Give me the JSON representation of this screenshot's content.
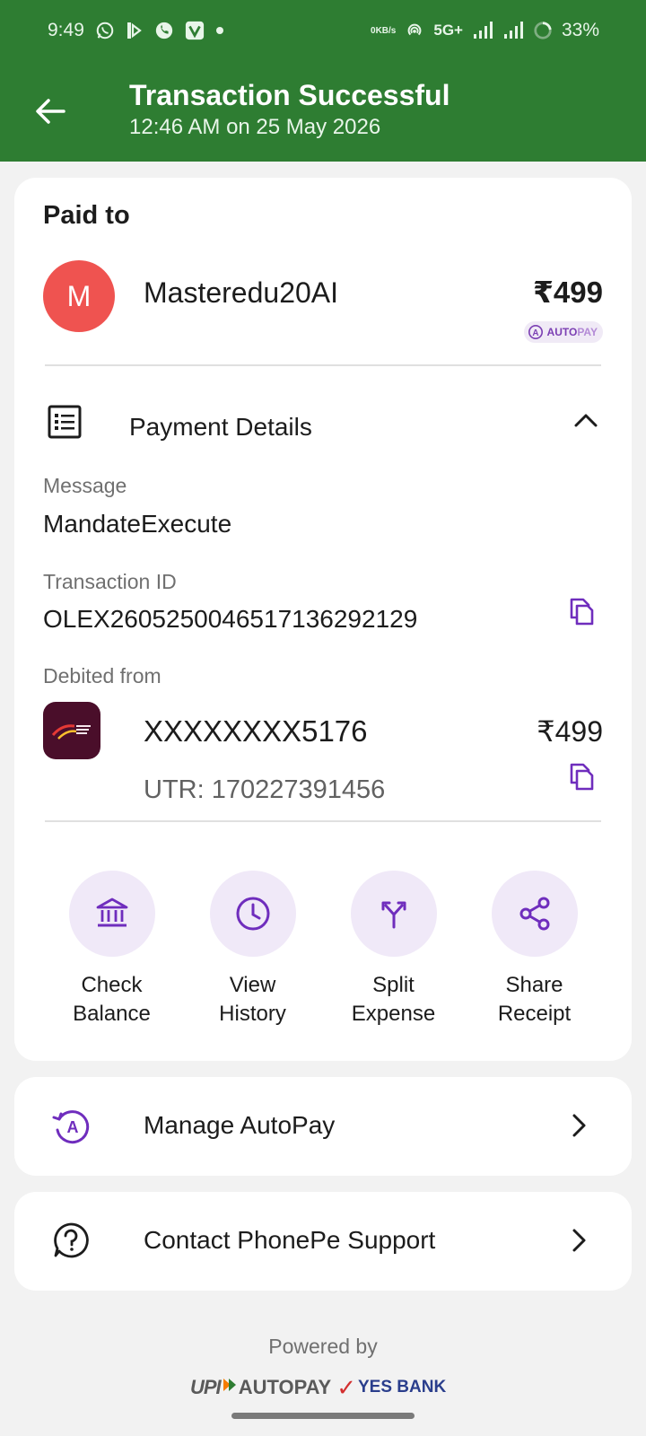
{
  "status": {
    "time": "9:49",
    "kbs_value": "0",
    "kbs_unit": "KB/s",
    "network": "5G+",
    "battery": "33%"
  },
  "header": {
    "title": "Transaction Successful",
    "subtitle": "12:46 AM on 25 May 2026",
    "bg_color": "#2e7d32"
  },
  "payee": {
    "section_title": "Paid to",
    "avatar_letter": "M",
    "name": "Masteredu20AI",
    "amount": "₹499",
    "badge_auto": "AUTO",
    "badge_pay": "PAY"
  },
  "payment_details": {
    "label": "Payment Details",
    "message_label": "Message",
    "message_value": "MandateExecute",
    "txn_label": "Transaction ID",
    "txn_value": "OLEX26052500465171362921​29",
    "debited_label": "Debited from",
    "account": "XXXXXXXX5176",
    "account_amount": "₹499",
    "utr": "UTR: 170227391456"
  },
  "actions": [
    {
      "label": "Check\nBalance",
      "icon": "bank-icon"
    },
    {
      "label": "View\nHistory",
      "icon": "clock-icon"
    },
    {
      "label": "Split\nExpense",
      "icon": "split-icon"
    },
    {
      "label": "Share\nReceipt",
      "icon": "share-icon"
    }
  ],
  "rows": {
    "autopay": "Manage AutoPay",
    "support": "Contact PhonePe Support"
  },
  "footer": {
    "powered_by": "Powered by",
    "upi": "UPI",
    "autopay": "AUTOPAY",
    "bank": "YES BANK"
  },
  "colors": {
    "accent_purple": "#6f2dbd",
    "icon_bg": "#f0e9f8",
    "avatar": "#ef5350"
  }
}
